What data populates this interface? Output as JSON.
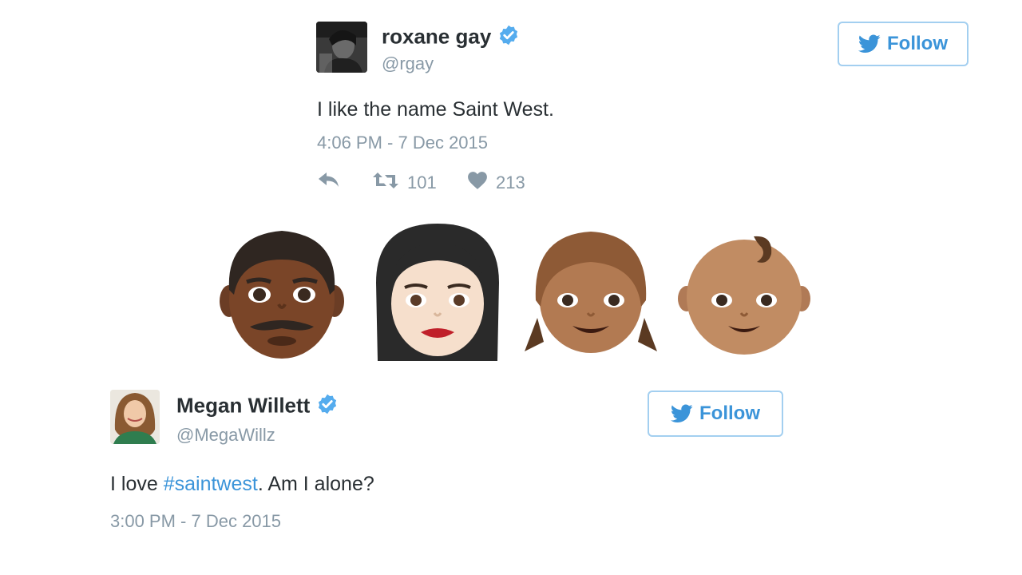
{
  "tweet1": {
    "name": "roxane gay",
    "handle": "@rgay",
    "text": "I like the name Saint West.",
    "timestamp": "4:06 PM - 7 Dec 2015",
    "retweets": "101",
    "likes": "213",
    "follow_label": "Follow"
  },
  "emoji_row": {
    "icons": [
      "man-dark-skin-emoji",
      "woman-light-skin-emoji",
      "girl-medium-skin-emoji",
      "baby-medium-skin-emoji"
    ]
  },
  "tweet2": {
    "name": "Megan Willett",
    "handle": "@MegaWillz",
    "text_before": "I love ",
    "hashtag": "#saintwest",
    "text_after": ". Am I alone?",
    "timestamp": "3:00 PM - 7 Dec 2015",
    "follow_label": "Follow"
  },
  "colors": {
    "twitter_blue": "#3b94d9",
    "verified_blue": "#55acee",
    "muted_text": "#8899a6"
  }
}
